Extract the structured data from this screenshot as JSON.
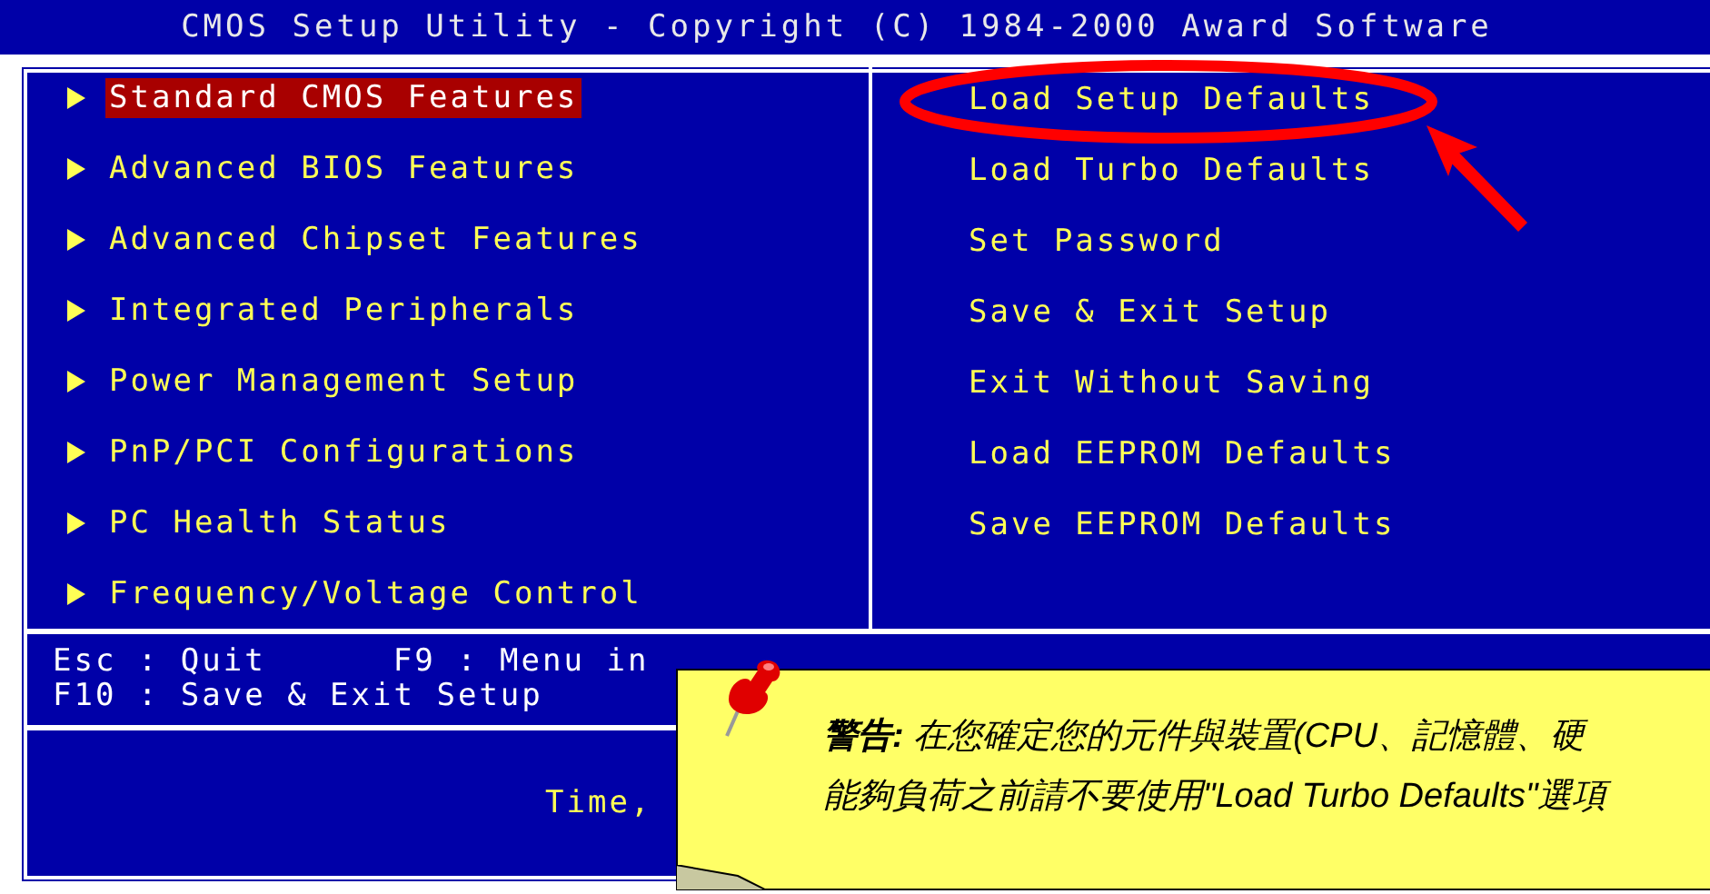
{
  "title_bar": {
    "title": "CMOS Setup Utility - Copyright (C) 1984-2000 Award Software"
  },
  "left_menu": [
    {
      "label": "Standard CMOS Features",
      "kind": "submenu",
      "selected": true
    },
    {
      "label": "Advanced BIOS Features",
      "kind": "submenu",
      "selected": false
    },
    {
      "label": "Advanced Chipset Features",
      "kind": "submenu",
      "selected": false
    },
    {
      "label": "Integrated Peripherals",
      "kind": "submenu",
      "selected": false
    },
    {
      "label": "Power Management Setup",
      "kind": "submenu",
      "selected": false
    },
    {
      "label": "PnP/PCI Configurations",
      "kind": "submenu",
      "selected": false
    },
    {
      "label": "PC Health Status",
      "kind": "submenu",
      "selected": false
    },
    {
      "label": "Frequency/Voltage Control",
      "kind": "submenu",
      "selected": false
    }
  ],
  "right_menu": [
    {
      "label": "Load Setup Defaults",
      "kind": "action",
      "selected": false
    },
    {
      "label": "Load Turbo Defaults",
      "kind": "action",
      "selected": false
    },
    {
      "label": "Set Password",
      "kind": "action",
      "selected": false
    },
    {
      "label": "Save & Exit Setup",
      "kind": "action",
      "selected": false
    },
    {
      "label": "Exit Without Saving",
      "kind": "action",
      "selected": false
    },
    {
      "label": "Load EEPROM Defaults",
      "kind": "action",
      "selected": false
    },
    {
      "label": "Save EEPROM Defaults",
      "kind": "action",
      "selected": false
    }
  ],
  "key_help": [
    [
      "Esc : Quit",
      "F9 : Menu in"
    ],
    [
      "F10 : Save & Exit Setup"
    ]
  ],
  "status_line": "Time,",
  "note": {
    "lines": [
      "**警告:** 在您確定您的元件與裝置(CPU、記憶體、硬",
      "能夠負荷之前請不要使用\"Load Turbo Defaults\"選項"
    ]
  }
}
